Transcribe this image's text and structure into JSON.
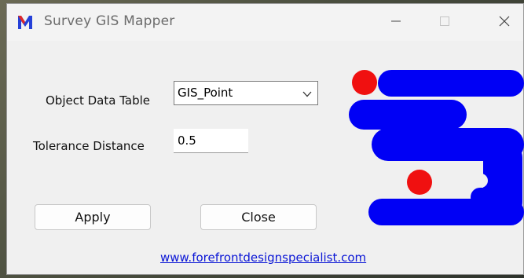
{
  "window": {
    "title": "Survey GIS Mapper",
    "app_icon": "m-logo-icon",
    "controls": [
      "minimize-icon",
      "maximize-icon",
      "close-icon"
    ]
  },
  "form": {
    "object_data_table_label": "Object Data Table",
    "object_data_table_value": "GIS_Point",
    "tolerance_label": "Tolerance Distance",
    "tolerance_value": "0.5"
  },
  "buttons": {
    "apply_label": "Apply",
    "close_label": "Close"
  },
  "footer": {
    "link_text": "www.forefrontdesignspecialist.com"
  },
  "logo": {
    "icon": "company-s-logo",
    "primary_color": "#0000f5",
    "accent_color": "#f01010"
  }
}
